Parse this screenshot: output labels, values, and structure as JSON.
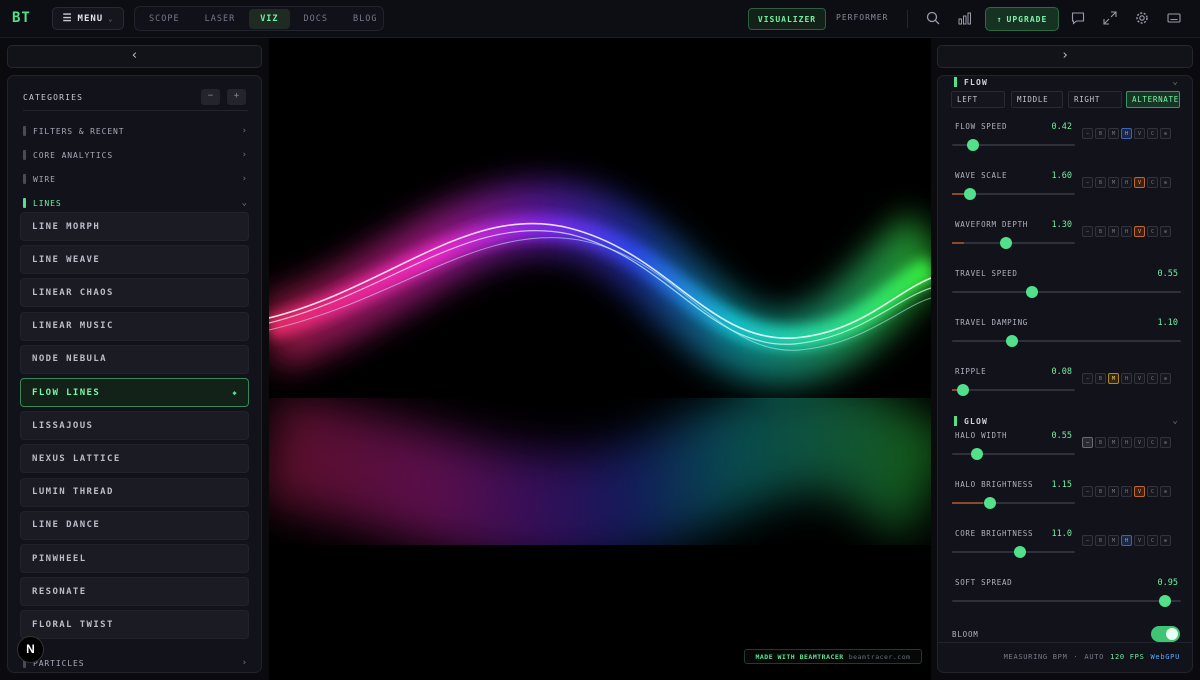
{
  "topbar": {
    "logo": "BT",
    "menu_label": "MENU",
    "nav": [
      "SCOPE",
      "LASER",
      "VIZ",
      "DOCS",
      "BLOG"
    ],
    "active_nav": "VIZ",
    "mode_visualizer": "VISUALIZER",
    "mode_performer": "PERFORMER",
    "upgrade_label": "UPGRADE",
    "icons": [
      "search-icon",
      "bar-chart-icon",
      "chat-icon",
      "expand-icon",
      "gear-icon",
      "keyboard-icon"
    ]
  },
  "left_panel": {
    "collapse_glyph": "‹",
    "title": "CATEGORIES",
    "minus": "−",
    "plus": "+",
    "categories": [
      {
        "label": "FILTERS & RECENT"
      },
      {
        "label": "CORE ANALYTICS"
      },
      {
        "label": "WIRE"
      },
      {
        "label": "LINES"
      }
    ],
    "items": [
      "LINE MORPH",
      "LINE WEAVE",
      "LINEAR CHAOS",
      "LINEAR MUSIC",
      "NODE NEBULA",
      "FLOW LINES",
      "LISSAJOUS",
      "NEXUS LATTICE",
      "LUMIN THREAD",
      "LINE DANCE",
      "PINWHEEL",
      "RESONATE",
      "FLORAL TWIST"
    ],
    "selected_item": "FLOW LINES",
    "bottom_category": "PARTICLES",
    "badge": "N"
  },
  "center": {
    "credit_main": "MADE WITH BEAMTRACER",
    "credit_url": "beamtracer.com"
  },
  "right_panel": {
    "collapse_glyph": "›",
    "flow": {
      "title": "FLOW",
      "modes": [
        "LEFT",
        "MIDDLE",
        "RIGHT",
        "ALTERNATE"
      ],
      "active_mode": "ALTERNATE",
      "params": [
        {
          "label": "FLOW SPEED",
          "value": "0.42",
          "level": 0.17,
          "mods": [
            "−",
            "B",
            "M",
            "H",
            "V",
            "C",
            "⊕"
          ],
          "active_mod": 3,
          "mod_color": "blue",
          "fill": 0
        },
        {
          "label": "WAVE SCALE",
          "value": "1.60",
          "level": 0.15,
          "mods": [
            "−",
            "B",
            "M",
            "H",
            "V",
            "C",
            "⊕"
          ],
          "active_mod": 4,
          "mod_color": "orange",
          "fill": 0.15
        },
        {
          "label": "WAVEFORM DEPTH",
          "value": "1.30",
          "level": 0.44,
          "mods": [
            "−",
            "B",
            "M",
            "H",
            "V",
            "C",
            "⊕"
          ],
          "active_mod": 4,
          "mod_color": "orange",
          "fill": 0.1
        },
        {
          "label": "TRAVEL SPEED",
          "value": "0.55",
          "level": 0.35,
          "mods": null
        },
        {
          "label": "TRAVEL DAMPING",
          "value": "1.10",
          "level": 0.26,
          "mods": null
        },
        {
          "label": "RIPPLE",
          "value": "0.08",
          "level": 0.09,
          "mods": [
            "−",
            "B",
            "M",
            "H",
            "V",
            "C",
            "⊕"
          ],
          "active_mod": 2,
          "mod_color": "amber",
          "fill": 0.05
        }
      ]
    },
    "glow": {
      "title": "GLOW",
      "params": [
        {
          "label": "HALO WIDTH",
          "value": "0.55",
          "level": 0.2,
          "mods": [
            "−",
            "B",
            "M",
            "H",
            "V",
            "C",
            "⊕"
          ],
          "active_mod": 0,
          "mod_color": "gray",
          "fill": 0
        },
        {
          "label": "HALO BRIGHTNESS",
          "value": "1.15",
          "level": 0.31,
          "mods": [
            "−",
            "B",
            "M",
            "H",
            "V",
            "C",
            "⊕"
          ],
          "active_mod": 4,
          "mod_color": "orange",
          "fill": 0.25
        },
        {
          "label": "CORE BRIGHTNESS",
          "value": "11.0",
          "level": 0.55,
          "mods": [
            "−",
            "B",
            "M",
            "H",
            "V",
            "C",
            "⊕"
          ],
          "active_mod": 3,
          "mod_color": "blue",
          "fill": 0
        },
        {
          "label": "SOFT SPREAD",
          "value": "0.95",
          "level": 0.93,
          "mods": null
        }
      ]
    },
    "bloom_label": "BLOOM",
    "bloom_on": true,
    "status": {
      "measuring": "MEASURING BPM",
      "auto": "AUTO",
      "fps": "120 FPS",
      "gpu": "WebGPU"
    }
  },
  "colors": {
    "accent": "#52e08a",
    "background": "#0a0a0f",
    "panel": "#12121a"
  }
}
